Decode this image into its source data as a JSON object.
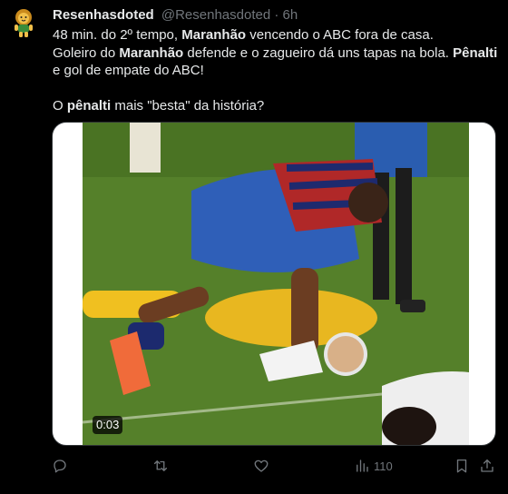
{
  "author": {
    "display_name": "Resenhasdoted",
    "handle": "@Resenhasdoted",
    "separator": "·",
    "time": "6h",
    "avatar_icon": "lion-mascot-icon"
  },
  "tweet": {
    "line1_a": "48 min. do 2º tempo, ",
    "line1_b": "Maranhão",
    "line1_c": " vencendo o ABC fora de casa.",
    "line2_a": "Goleiro do ",
    "line2_b": "Maranhão",
    "line2_c": " defende e o zagueiro dá uns tapas na bola. ",
    "line2_d": "Pênalti",
    "line2_e": " e gol de empate do ABC!",
    "line3_a": "O ",
    "line3_b": "pênalti",
    "line3_c": " mais \"besta\" da história?"
  },
  "media": {
    "type": "video",
    "timestamp": "0:03"
  },
  "actions": {
    "reply_icon": "reply-icon",
    "retweet_icon": "retweet-icon",
    "like_icon": "heart-icon",
    "views_icon": "views-icon",
    "views_count": "110",
    "bookmark_icon": "bookmark-icon",
    "share_icon": "share-icon"
  },
  "colors": {
    "background": "#000000",
    "text": "#e7e9ea",
    "muted": "#71767b",
    "pitch": "#4f7a24"
  }
}
